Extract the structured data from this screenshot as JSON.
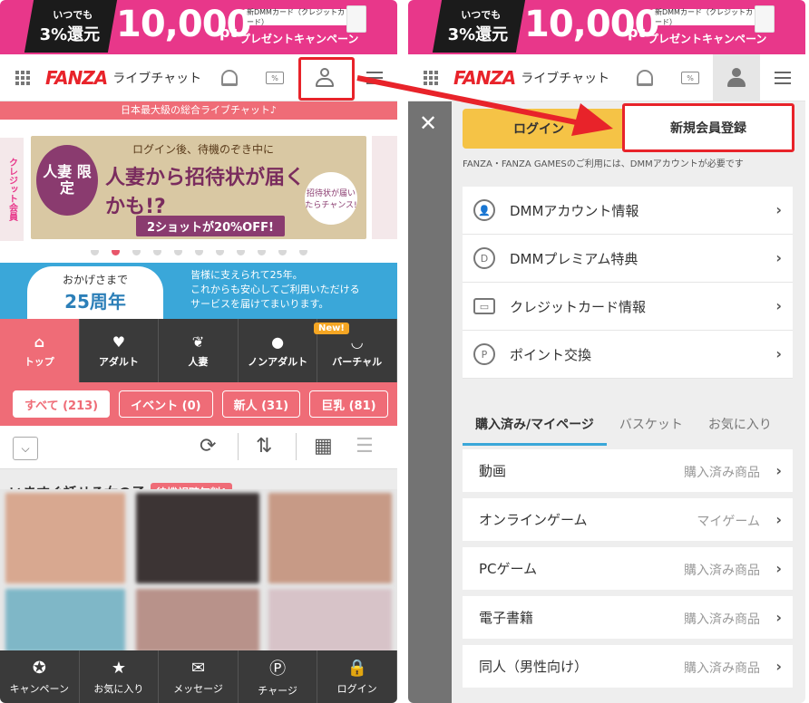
{
  "promo": {
    "badge_line1": "いつでも",
    "badge_line2": "3%還元",
    "amount": "10,000",
    "unit": "pt",
    "subtitle": "プレゼントキャンペーン",
    "card_label": "新DMMカード（クレジットカード）"
  },
  "header": {
    "logo": "FANZA",
    "service": "ライブチャット",
    "points_icon_text": "%"
  },
  "left": {
    "tagline": "日本最大級の総合ライブチャット♪",
    "banner": {
      "badge": "人妻 限定",
      "line1": "ログイン後、待機のぞき中に",
      "line2": "人妻から招待状が届くかも!?",
      "cta": "2ショットが20%OFF!",
      "bubble": "招待状が届いたらチャンス!",
      "side_left": "クレジット会員"
    },
    "dots_count": 11,
    "dots_active": 1,
    "anniversary": {
      "line1": "おかげさまで",
      "line2": "25周年",
      "text": "皆様に支えられて25年。\nこれからも安心してご利用いただける\nサービスを届けてまいります。"
    },
    "categories": [
      {
        "icon": "home-icon",
        "label": "トップ",
        "active": true
      },
      {
        "icon": "heart-icon",
        "label": "アダルト",
        "active": false
      },
      {
        "icon": "butterfly-icon",
        "label": "人妻",
        "active": false
      },
      {
        "icon": "speech-bubble-icon",
        "label": "ノンアダルト",
        "active": false
      },
      {
        "icon": "bunny-icon",
        "label": "バーチャル",
        "active": false
      }
    ],
    "new_badge": "New!",
    "filters": [
      {
        "label": "すべて (213)",
        "active": true
      },
      {
        "label": "イベント (0)",
        "active": false
      },
      {
        "label": "新人 (31)",
        "active": false
      },
      {
        "label": "巨乳 (81)",
        "active": false
      }
    ],
    "section_title": "いますぐ話せる女の子",
    "section_badge": "待機視聴無料!",
    "bottom_nav": [
      {
        "icon": "award-icon",
        "label": "キャンペーン"
      },
      {
        "icon": "star-icon",
        "label": "お気に入り"
      },
      {
        "icon": "mail-icon",
        "label": "メッセージ"
      },
      {
        "icon": "point-icon",
        "label": "チャージ"
      },
      {
        "icon": "lock-icon",
        "label": "ログイン"
      }
    ]
  },
  "right": {
    "login_label": "ログイン",
    "register_label": "新規会員登録",
    "note": "FANZA・FANZA GAMESのご利用には、DMMアカウントが必要です",
    "account_menu": [
      {
        "icon": "user-icon",
        "label": "DMMアカウント情報"
      },
      {
        "icon": "premium-icon",
        "label": "DMMプレミアム特典"
      },
      {
        "icon": "credit-card-icon",
        "label": "クレジットカード情報"
      },
      {
        "icon": "point-exchange-icon",
        "label": "ポイント交換"
      }
    ],
    "tabs": [
      {
        "label": "購入済み/マイページ",
        "active": true
      },
      {
        "label": "バスケット",
        "active": false
      },
      {
        "label": "お気に入り",
        "active": false
      }
    ],
    "purchase_menu": [
      {
        "label": "動画",
        "sub": "購入済み商品"
      },
      {
        "label": "オンラインゲーム",
        "sub": "マイゲーム"
      },
      {
        "label": "PCゲーム",
        "sub": "購入済み商品"
      },
      {
        "label": "電子書籍",
        "sub": "購入済み商品"
      },
      {
        "label": "同人（男性向け）",
        "sub": "購入済み商品"
      }
    ]
  },
  "colors": {
    "promo_pink": "#e8378a",
    "brand_red": "#e8232a",
    "coral": "#ef6c77",
    "login_yellow": "#f5c346",
    "tab_blue": "#3aa7d9"
  }
}
